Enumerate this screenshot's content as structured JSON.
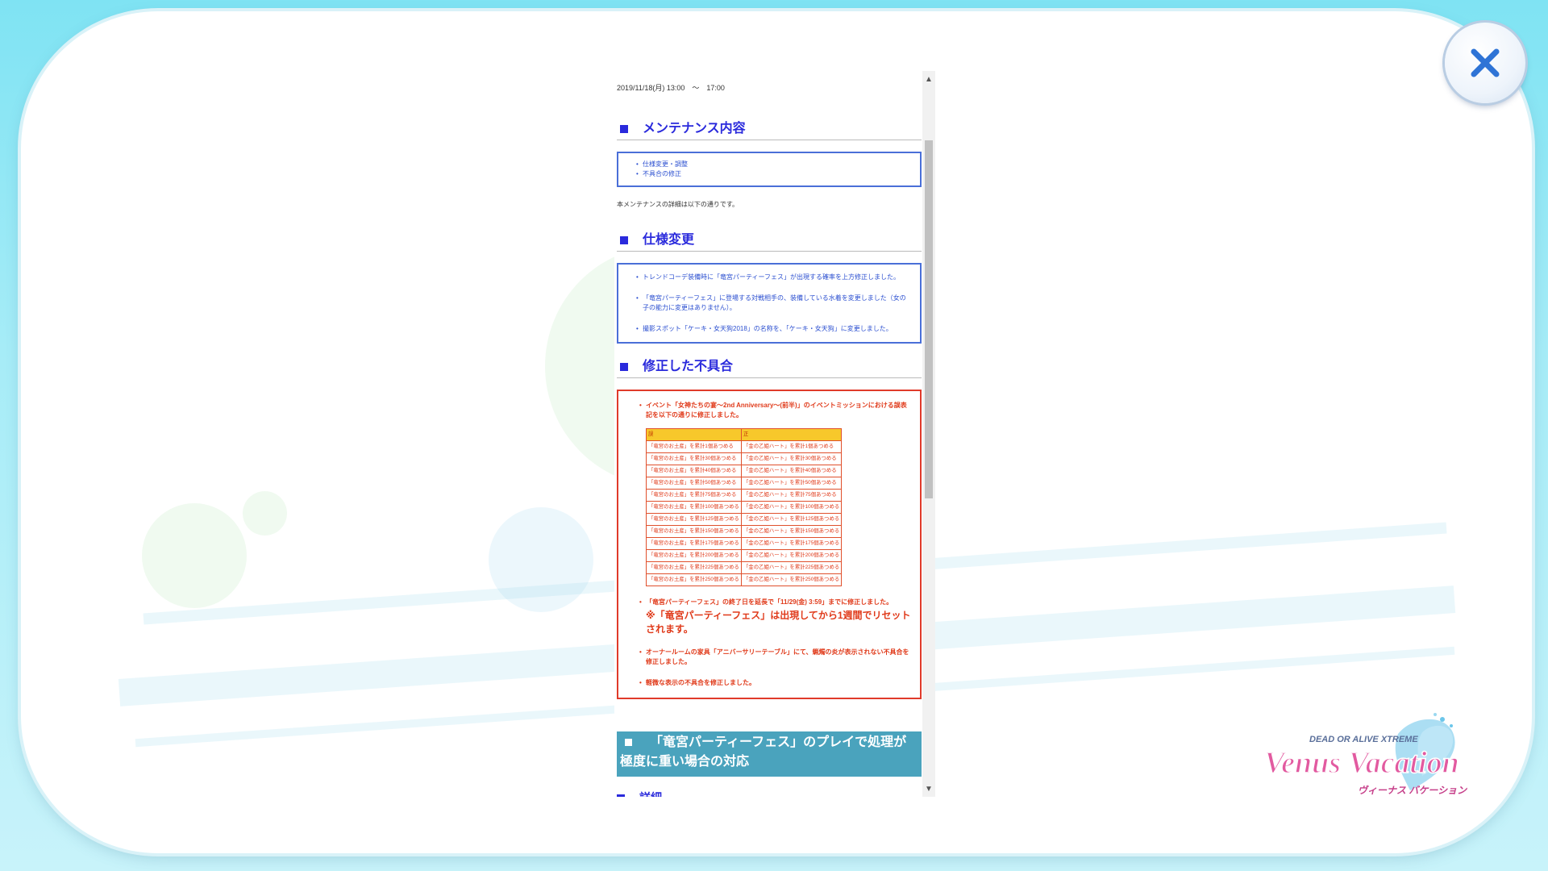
{
  "close_label": "close",
  "logo": {
    "line1": "DEAD OR ALIVE XTREME",
    "line2": "Venus Vacation",
    "line3": "ヴィーナス バケーション"
  },
  "notice": {
    "date": "2019/11/18(月) 13:00　～　17:00",
    "section1": {
      "title": "メンテナンス内容",
      "items": [
        "仕様変更・調整",
        "不具合の修正"
      ]
    },
    "note": "本メンテナンスの詳細は以下の通りです。",
    "section2": {
      "title": "仕様変更",
      "items": [
        "トレンドコーデ装備時に「竜宮パーティーフェス」が出現する確率を上方修正しました。",
        "「竜宮パーティーフェス」に登場する対戦相手の、装備している水着を変更しました（女の子の能力に変更はありません）。",
        "撮影スポット「ケーキ・女天狗2018」の名称を、「ケーキ・女天狗」に変更しました。"
      ]
    },
    "section3": {
      "title": "修正した不具合",
      "item1": "イベント「女神たちの宴～2nd Anniversary～(前半)」のイベントミッションにおける誤表記を以下の通りに修正しました。",
      "table": {
        "headers": [
          "誤",
          "正"
        ],
        "rows": [
          [
            "「竜宮のお土産」を累計1個あつめる",
            "「金の乙姫ハート」を累計1個あつめる"
          ],
          [
            "「竜宮のお土産」を累計30個あつめる",
            "「金の乙姫ハート」を累計30個あつめる"
          ],
          [
            "「竜宮のお土産」を累計40個あつめる",
            "「金の乙姫ハート」を累計40個あつめる"
          ],
          [
            "「竜宮のお土産」を累計50個あつめる",
            "「金の乙姫ハート」を累計50個あつめる"
          ],
          [
            "「竜宮のお土産」を累計75個あつめる",
            "「金の乙姫ハート」を累計75個あつめる"
          ],
          [
            "「竜宮のお土産」を累計100個あつめる",
            "「金の乙姫ハート」を累計100個あつめる"
          ],
          [
            "「竜宮のお土産」を累計125個あつめる",
            "「金の乙姫ハート」を累計125個あつめる"
          ],
          [
            "「竜宮のお土産」を累計150個あつめる",
            "「金の乙姫ハート」を累計150個あつめる"
          ],
          [
            "「竜宮のお土産」を累計175個あつめる",
            "「金の乙姫ハート」を累計175個あつめる"
          ],
          [
            "「竜宮のお土産」を累計200個あつめる",
            "「金の乙姫ハート」を累計200個あつめる"
          ],
          [
            "「竜宮のお土産」を累計225個あつめる",
            "「金の乙姫ハート」を累計225個あつめる"
          ],
          [
            "「竜宮のお土産」を累計250個あつめる",
            "「金の乙姫ハート」を累計250個あつめる"
          ]
        ]
      },
      "item2": "「竜宮パーティーフェス」の終了日を延長で「11/29(金) 3:59」までに修正しました。",
      "item2_big": "※「竜宮パーティーフェス」は出現してから1週間でリセットされます。",
      "item3": "オーナールームの家具「アニバーサリーテーブル」にて、蝋燭の炎が表示されない不具合を修正しました。",
      "item4": "軽微な表示の不具合を修正しました。"
    },
    "teal_heading": "「竜宮パーティーフェス」のプレイで処理が極度に重い場合の対応",
    "cut_heading": "詳細"
  }
}
